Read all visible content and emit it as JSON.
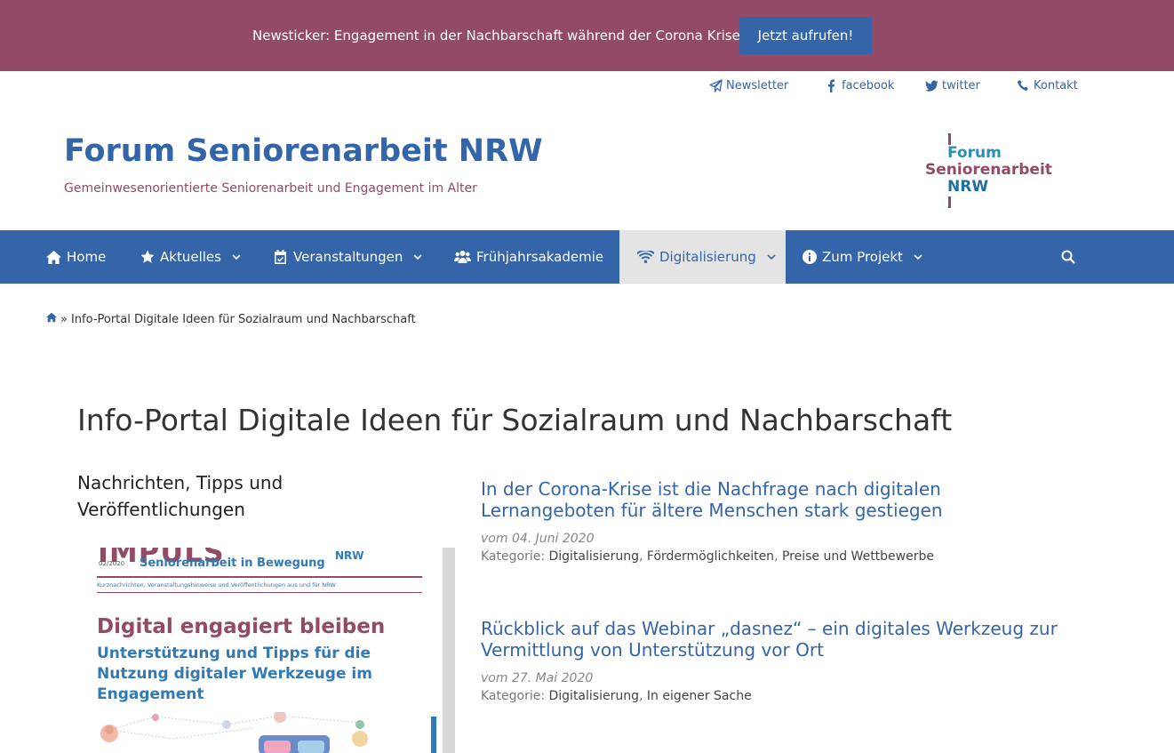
{
  "ticker": {
    "text": "Newsticker: Engagement in der Nachbarschaft während der Corona Krise",
    "button": "Jetzt aufrufen!"
  },
  "toplinks": [
    {
      "label": "Newsletter",
      "icon": "paper-plane-icon"
    },
    {
      "label": "facebook",
      "icon": "facebook-icon"
    },
    {
      "label": "twitter",
      "icon": "twitter-icon"
    },
    {
      "label": "Kontakt",
      "icon": "phone-icon"
    }
  ],
  "header": {
    "title": "Forum Seniorenarbeit NRW",
    "description": "Gemeinwesenorientierte Seniorenarbeit und Engagement im Alter",
    "logo": {
      "line1": "Forum",
      "line2": "Seniorenarbeit",
      "line3": "NRW"
    }
  },
  "nav": {
    "items": [
      {
        "label": "Home",
        "icon": "home-icon"
      },
      {
        "label": "Aktuelles",
        "icon": "star-icon"
      },
      {
        "label": "Veranstaltungen",
        "icon": "calendar-icon"
      },
      {
        "label": "Frühjahrsakademie",
        "icon": "users-icon"
      },
      {
        "label": "Digitalisierung",
        "icon": "wifi-icon",
        "active": true
      },
      {
        "label": "Zum Projekt",
        "icon": "info-icon"
      }
    ],
    "search_icon": "search-icon"
  },
  "breadcrumb": {
    "separator": "»",
    "current": "Info-Portal Digitale Ideen für Sozialraum und Nachbarschaft"
  },
  "page": {
    "title": "Info-Portal Digitale Ideen für Sozialraum und Nachbarschaft"
  },
  "sidebar": {
    "heading": "Nachrichten, Tipps und Veröffentlichungen",
    "cover": {
      "masthead": "IMPULS",
      "issue": "02/2020",
      "subtitle": "Seniorenarbeit in Bewegung",
      "nrw": "NRW",
      "meta": "Kurznachrichten, Veranstaltungshinweise und Veröffentlichungen aus und für NRW",
      "headline": "Digital engagiert bleiben",
      "subheadline": "Unterstützung und Tipps für die Nutzung digitaler Werkzeuge im Engagement"
    }
  },
  "posts": [
    {
      "title": "In der Corona-Krise ist die Nachfrage nach digitalen Lernangeboten für ältere Menschen stark gestiegen",
      "date": "vom 04. Juni 2020",
      "category_label": "Kategorie:",
      "categories": [
        "Digitalisierung",
        "Fördermöglichkeiten",
        "Preise und Wettbewerbe"
      ]
    },
    {
      "title": "Rückblick auf das Webinar „dasnez“ – ein digitales Werkzeug zur Vermittlung von Unterstützung vor Ort",
      "date": "vom 27. Mai 2020",
      "category_label": "Kategorie:",
      "categories": [
        "Digitalisierung",
        "In eigener Sache"
      ]
    }
  ],
  "colors": {
    "ticker_bg": "#924a66",
    "brand_blue": "#3465a9",
    "brand_red": "#924a66",
    "active_nav_bg": "#e4e4e4"
  }
}
